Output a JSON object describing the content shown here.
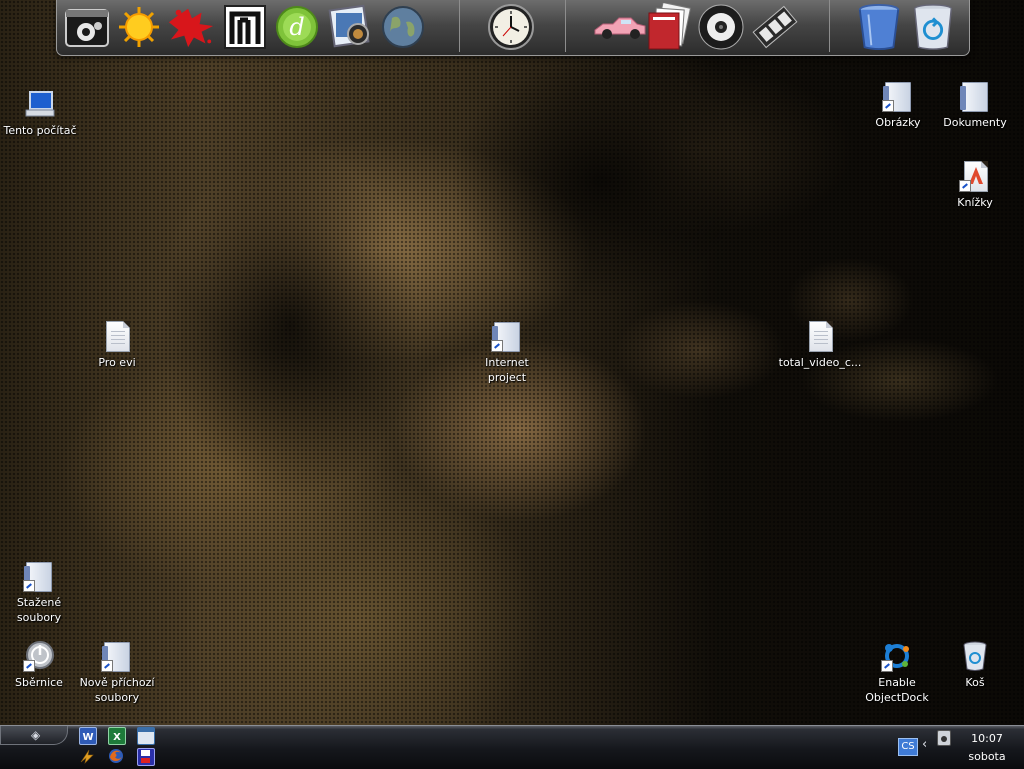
{
  "dock": {
    "items": [
      {
        "name": "system-settings-icon"
      },
      {
        "name": "weather-sun-icon"
      },
      {
        "name": "red-splat-app-icon"
      },
      {
        "name": "m-letter-app-icon"
      },
      {
        "name": "dreamweaver-icon"
      },
      {
        "name": "image-viewer-icon"
      },
      {
        "name": "globe-icon"
      },
      {
        "name": "clock-widget-icon"
      },
      {
        "name": "pink-car-icon"
      },
      {
        "name": "documents-stack-icon"
      },
      {
        "name": "dvd-disc-icon"
      },
      {
        "name": "film-strip-icon"
      },
      {
        "name": "trash-empty-icon"
      },
      {
        "name": "recycle-bin-icon"
      }
    ]
  },
  "desktop": {
    "icons": [
      {
        "key": "computer",
        "label": "Tento počítač"
      },
      {
        "key": "pictures",
        "label": "Obrázky"
      },
      {
        "key": "documents",
        "label": "Dokumenty"
      },
      {
        "key": "books",
        "label": "Knížky"
      },
      {
        "key": "pro-evi",
        "label": "Pro evi"
      },
      {
        "key": "internet-project",
        "label": "Internet project"
      },
      {
        "key": "total-video",
        "label": "total_video_c..."
      },
      {
        "key": "downloads",
        "label": "Stažené soubory"
      },
      {
        "key": "bus",
        "label": "Sběrnice"
      },
      {
        "key": "new-incoming",
        "label": "Nově příchozí soubory"
      },
      {
        "key": "objectdock",
        "label": "Enable ObjectDock"
      },
      {
        "key": "trash",
        "label": "Koš"
      }
    ]
  },
  "taskbar": {
    "quick_launch": [
      {
        "name": "word-icon",
        "color": "#2f5bb7"
      },
      {
        "name": "excel-icon",
        "color": "#1e7b3a"
      },
      {
        "name": "window-app-icon",
        "color": "#3a6ea8"
      },
      {
        "name": "lightning-app-icon",
        "color": "#e3a021"
      },
      {
        "name": "firefox-icon",
        "color": "#e06a1d"
      },
      {
        "name": "save-disk-icon",
        "color": "#2a2fa8"
      }
    ],
    "tray": {
      "language": "CS",
      "time": "10:07",
      "day": "sobota"
    }
  }
}
